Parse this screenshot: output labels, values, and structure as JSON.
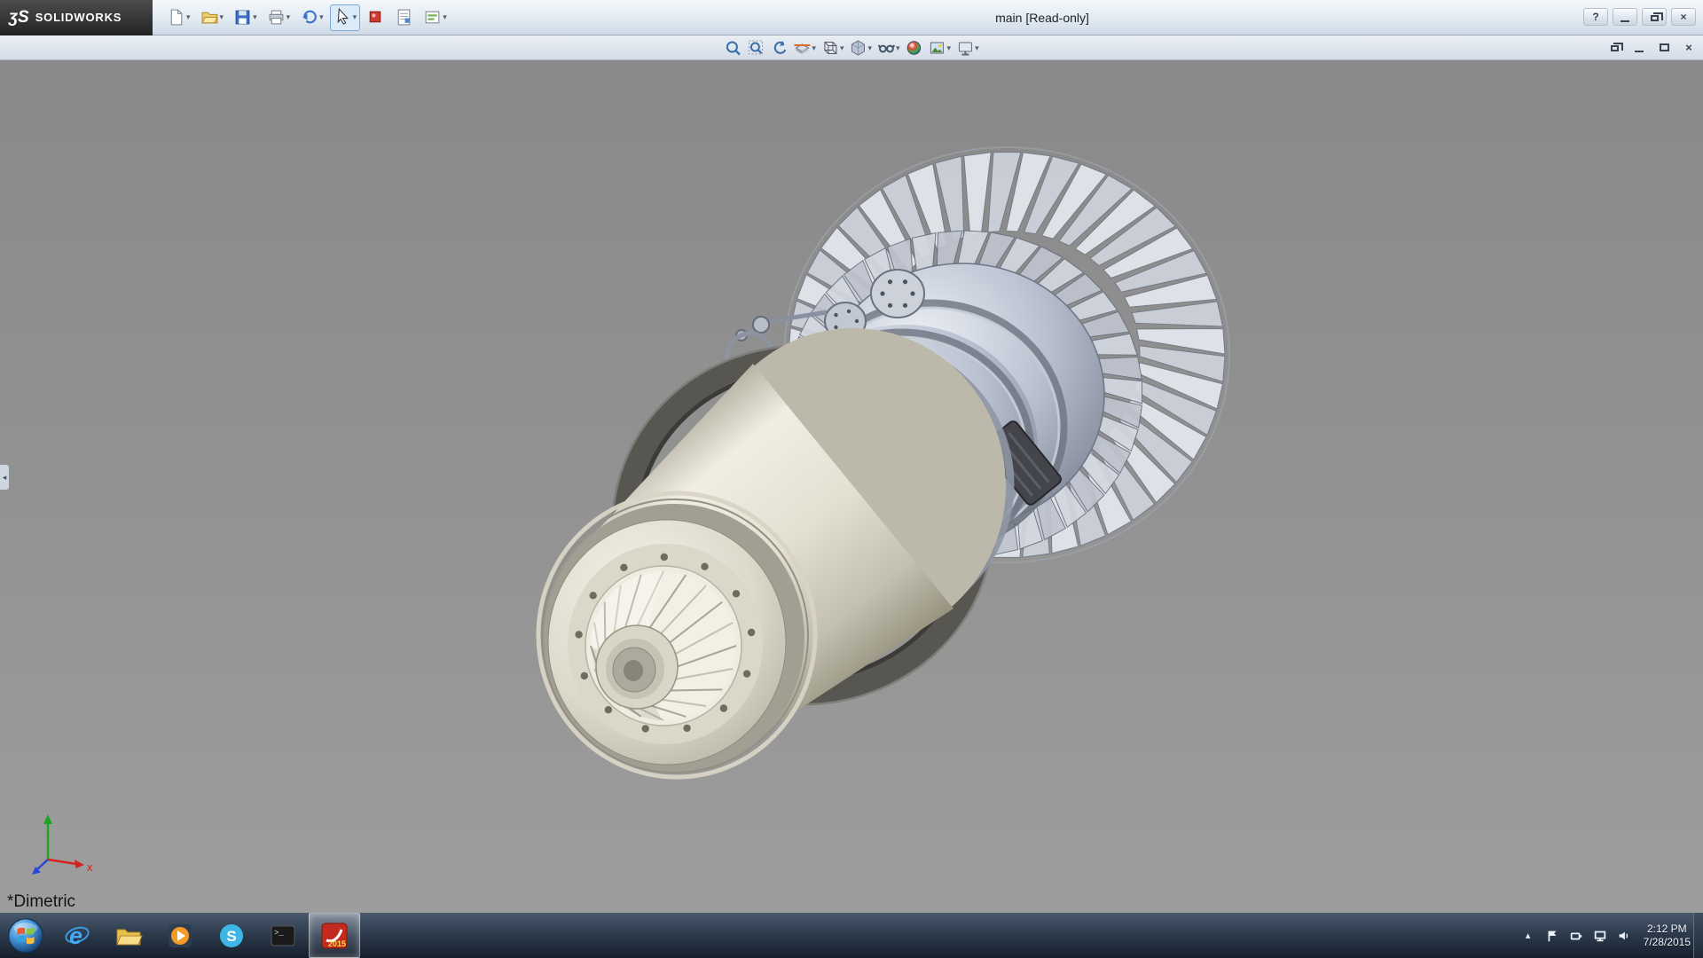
{
  "window": {
    "brand": "SOLIDWORKS",
    "title": "main [Read-only]",
    "controls": [
      {
        "id": "help",
        "glyph": "?"
      },
      {
        "id": "minimize"
      },
      {
        "id": "restore"
      },
      {
        "id": "close",
        "glyph": "×"
      }
    ]
  },
  "main_toolbar": {
    "items": [
      {
        "id": "new-document",
        "caret": true
      },
      {
        "id": "open",
        "caret": true
      },
      {
        "id": "save",
        "caret": true
      },
      {
        "id": "print",
        "caret": true
      },
      {
        "id": "undo",
        "caret": true
      },
      {
        "id": "select",
        "caret": true,
        "active": true
      },
      {
        "id": "appearance",
        "caret": false
      },
      {
        "id": "file-properties",
        "caret": false
      },
      {
        "id": "options",
        "caret": true
      }
    ]
  },
  "view_toolbar": {
    "items": [
      {
        "id": "zoom-to-fit"
      },
      {
        "id": "zoom-to-area"
      },
      {
        "id": "previous-view"
      },
      {
        "id": "section-view",
        "caret": true
      },
      {
        "id": "view-orientation",
        "caret": true
      },
      {
        "id": "display-style",
        "caret": true
      },
      {
        "id": "hide-show-items",
        "caret": true
      },
      {
        "id": "edit-appearance"
      },
      {
        "id": "apply-scene",
        "caret": true
      },
      {
        "id": "view-settings",
        "caret": true
      }
    ]
  },
  "document_window": {
    "controls": [
      {
        "id": "doc-restore"
      },
      {
        "id": "doc-minimize"
      },
      {
        "id": "doc-maximize"
      },
      {
        "id": "doc-close",
        "glyph": "×"
      }
    ]
  },
  "viewport": {
    "orientation_label": "*Dimetric",
    "triad": {
      "x_label": "x"
    }
  },
  "taskbar": {
    "items": [
      {
        "id": "internet-explorer"
      },
      {
        "id": "file-explorer"
      },
      {
        "id": "media-player"
      },
      {
        "id": "skype"
      },
      {
        "id": "command-prompt"
      },
      {
        "id": "solidworks",
        "active": true,
        "badge": "2015"
      }
    ],
    "tray": {
      "time": "2:12 PM",
      "date": "7/28/2015",
      "icons": [
        {
          "id": "tray-expand"
        },
        {
          "id": "action-center-flag"
        },
        {
          "id": "power-plug"
        },
        {
          "id": "display"
        },
        {
          "id": "volume"
        }
      ]
    }
  },
  "icons": {
    "logo": "ʒS",
    "caret": "▾",
    "tray_expand": "▴",
    "panel_collapse": "◂",
    "skype_letter": "S",
    "ie_letter": "e",
    "cmd_prompt": ">_"
  },
  "colors": {
    "viewport_background": "#909090",
    "titlebar": "#e2eaf2",
    "taskbar": "#2d3c4e",
    "select_highlight": "#dcebfa"
  }
}
